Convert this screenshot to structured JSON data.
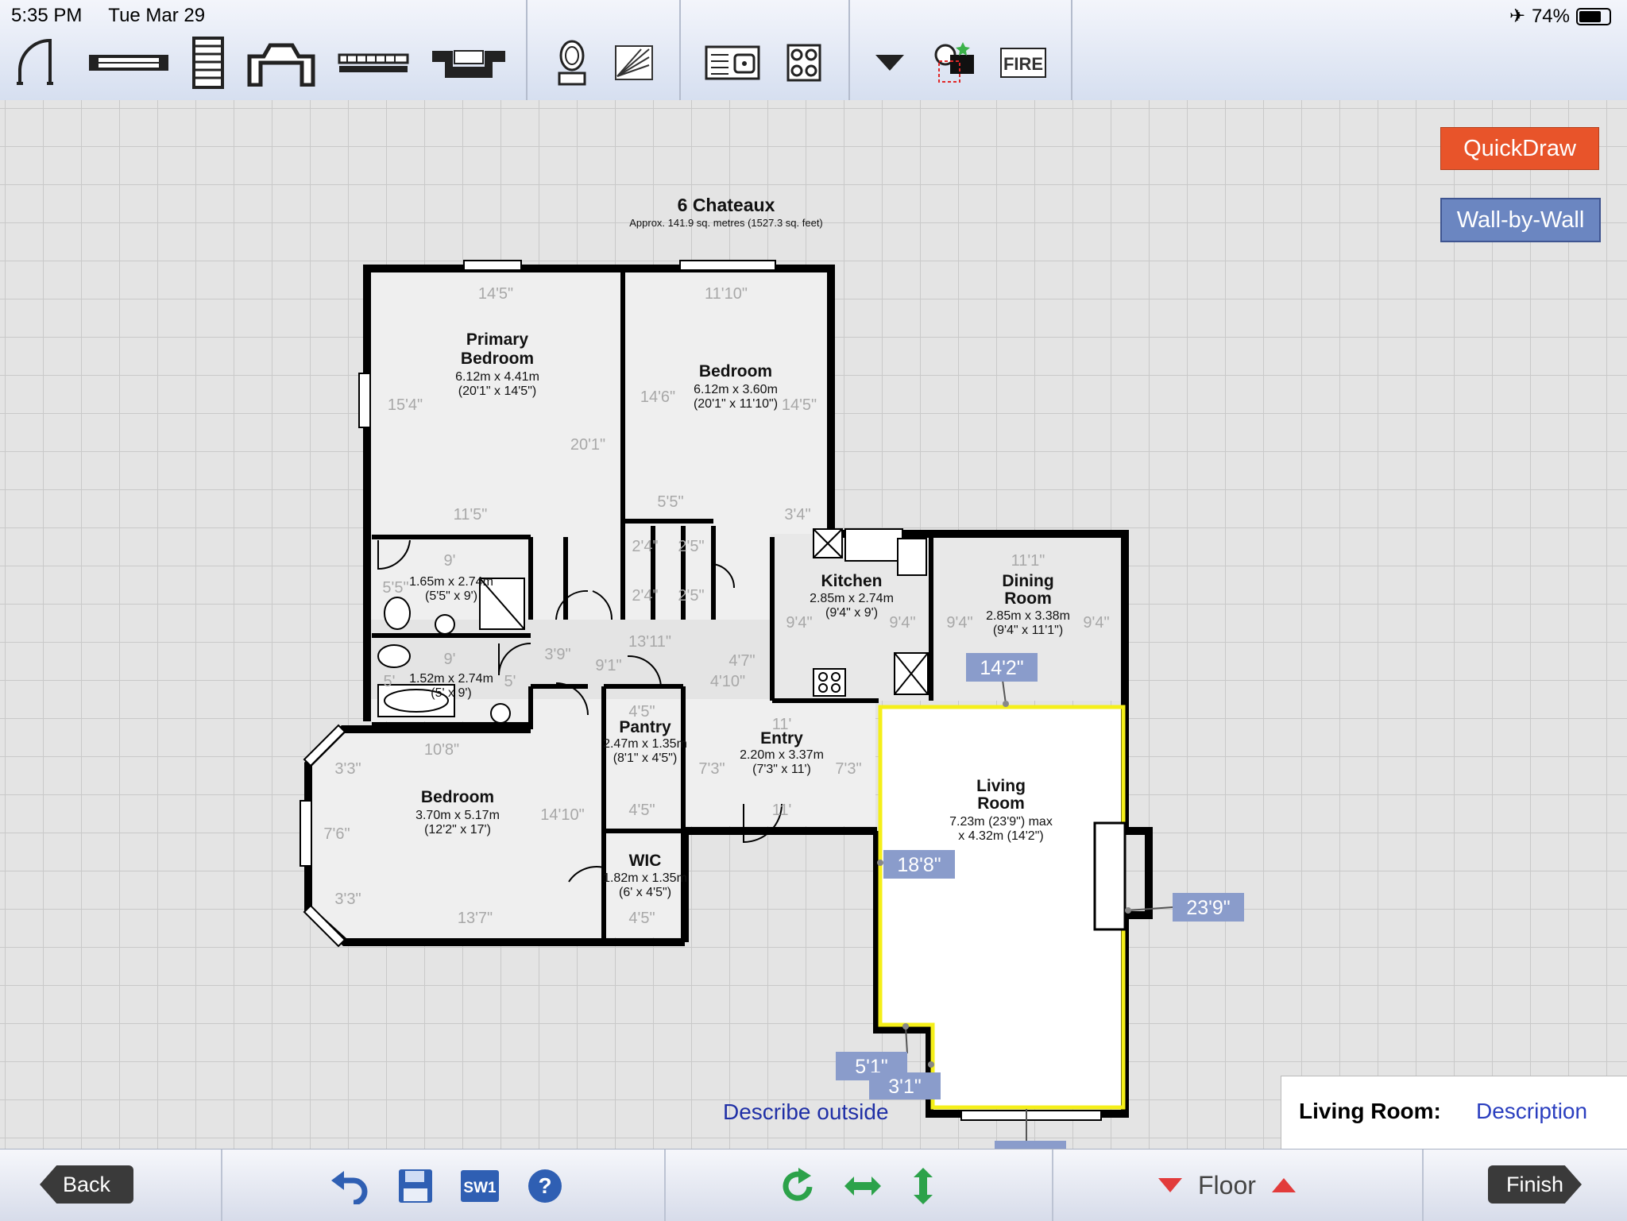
{
  "status": {
    "time": "5:35 PM",
    "date": "Tue Mar 29",
    "battery": "74%",
    "battery_level": 0.74
  },
  "toolbar": {
    "icons": [
      "door-swing-icon",
      "window-icon",
      "stairs-icon",
      "bay-icon",
      "radiator-icon",
      "recess-icon",
      "toilet-icon",
      "light-icon",
      "sink-unit-icon",
      "hob-icon",
      "dropdown-arrow-icon",
      "camera-icon",
      "fire-icon"
    ],
    "fire_label": "FIRE"
  },
  "buttons": {
    "quickdraw": "QuickDraw",
    "wall_by_wall": "Wall-by-Wall"
  },
  "plan": {
    "title": "6 Chateaux",
    "subtitle": "Approx. 141.9 sq. metres (1527.3 sq. feet)",
    "rooms": {
      "primary_bedroom": {
        "name1": "Primary",
        "name2": "Bedroom",
        "metric": "6.12m x 4.41m",
        "imperial": "(20'1\" x 14'5\")"
      },
      "bedroom_top": {
        "name": "Bedroom",
        "metric": "6.12m x 3.60m",
        "imperial": "(20'1\" x 11'10\")"
      },
      "ensuite": {
        "metric": "1.65m x 2.74m",
        "imperial": "(5'5\" x 9')"
      },
      "bathroom": {
        "metric": "1.52m x 2.74m",
        "imperial": "(5' x 9')"
      },
      "kitchen": {
        "name": "Kitchen",
        "metric": "2.85m x 2.74m",
        "imperial": "(9'4\" x 9')"
      },
      "dining": {
        "name1": "Dining",
        "name2": "Room",
        "metric": "2.85m x 3.38m",
        "imperial": "(9'4\" x 11'1\")"
      },
      "bedroom_bottom": {
        "name": "Bedroom",
        "metric": "3.70m x 5.17m",
        "imperial": "(12'2\" x 17')"
      },
      "pantry": {
        "name": "Pantry",
        "metric": "2.47m x 1.35m",
        "imperial": "(8'1\" x 4'5\")"
      },
      "entry": {
        "name": "Entry",
        "metric": "2.20m x 3.37m",
        "imperial": "(7'3\" x 11')"
      },
      "wic": {
        "name": "WIC",
        "metric": "1.82m x 1.35m",
        "imperial": "(6' x 4'5\")"
      },
      "living": {
        "name1": "Living",
        "name2": "Room",
        "metric": "7.23m (23'9\") max",
        "imperial": "x 4.32m (14'2\")"
      }
    },
    "dims": {
      "pb_top": "14'5\"",
      "pb_left": "15'4\"",
      "pb_right": "20'1\"",
      "pb_bottom": "11'5\"",
      "bt_top": "11'10\"",
      "bt_left": "14'6\"",
      "bt_right": "14'5\"",
      "bt_bottom_left": "5'5\"",
      "bt_bottom_right": "3'4\"",
      "ens_top": "9'",
      "ens_left": "5'5\"",
      "hall_a": "13'11\"",
      "hall_b": "3'9\"",
      "hall_c": "9'1\"",
      "hall_d": "4'7\"",
      "hall_e": "4'10\"",
      "bath_top": "9'",
      "bath_left": "5'",
      "bath_right": "5'",
      "kit_top": "11'1\"",
      "kit_left": "9'4\"",
      "kit_right": "9'4\"",
      "din_left": "9'4\"",
      "din_right": "9'4\"",
      "bb_top": "10'8\"",
      "bb_left_a": "3'3\"",
      "bb_left_b": "7'6\"",
      "bb_left_c": "3'3\"",
      "bb_right": "14'10\"",
      "bb_bottom": "13'7\"",
      "pan_top": "4'5\"",
      "pan_bottom": "4'5\"",
      "ent_top": "11'",
      "ent_left": "7'3\"",
      "ent_right": "7'3\"",
      "ent_bottom": "11'",
      "wic_bottom": "4'5\"",
      "cup_a": "2'4\"",
      "cup_b": "2'5\"",
      "cup_c": "2'4\"",
      "cup_d": "2'5\""
    },
    "tags": {
      "top": "14'2\"",
      "left": "18'8\"",
      "right": "23'9\"",
      "corner_a": "5'1\"",
      "corner_b": "3'1\""
    }
  },
  "description": {
    "label": "Living Room:",
    "value": "Description"
  },
  "describe_outside": "Describe outside",
  "bottom": {
    "back": "Back",
    "finish": "Finish",
    "floor": "Floor",
    "sw_label": "SW1"
  }
}
